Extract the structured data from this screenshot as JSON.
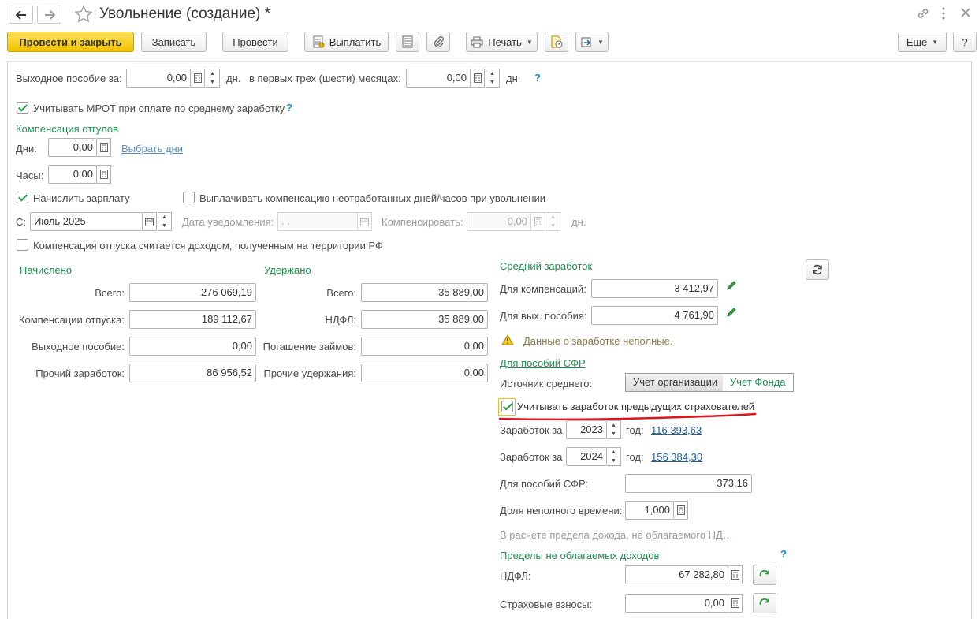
{
  "window": {
    "title": "Увольнение (создание) *"
  },
  "toolbar": {
    "post_close": "Провести и закрыть",
    "save": "Записать",
    "post": "Провести",
    "pay": "Выплатить",
    "print": "Печать",
    "more": "Еще",
    "help": "?"
  },
  "severance": {
    "label": "Выходное пособие за:",
    "days_value": "0,00",
    "days_unit": "дн.",
    "months_label": "в первых трех (шести) месяцах:",
    "months_value": "0,00",
    "months_unit": "дн.",
    "help": "?"
  },
  "mrot": {
    "label": "Учитывать МРОТ при оплате по среднему заработку",
    "checked": true,
    "help": "?"
  },
  "compensation_time_off": {
    "heading": "Компенсация отгулов",
    "days_label": "Дни:",
    "days_value": "0,00",
    "choose_days": "Выбрать дни",
    "hours_label": "Часы:",
    "hours_value": "0,00"
  },
  "salary": {
    "accrue_label": "Начислить зарплату",
    "accrue_checked": true,
    "pay_comp_label": "Выплачивать компенсацию неотработанных дней/часов при увольнении",
    "pay_comp_checked": false,
    "from_label": "С:",
    "from_value": "Июль 2025",
    "notice_label": "Дата уведомления:",
    "notice_value": " .  .",
    "compensate_label": "Компенсировать:",
    "compensate_value": "0,00",
    "compensate_unit": "дн."
  },
  "vacation_income": {
    "label": "Компенсация отпуска считается доходом, полученным на территории РФ",
    "checked": false
  },
  "accrued": {
    "heading": "Начислено",
    "total_label": "Всего:",
    "total_value": "276 069,19",
    "vacation_label": "Компенсации отпуска:",
    "vacation_value": "189 112,67",
    "severance_label": "Выходное пособие:",
    "severance_value": "0,00",
    "other_label": "Прочий заработок:",
    "other_value": "86 956,52"
  },
  "withheld": {
    "heading": "Удержано",
    "total_label": "Всего:",
    "total_value": "35 889,00",
    "ndfl_label": "НДФЛ:",
    "ndfl_value": "35 889,00",
    "loans_label": "Погашение займов:",
    "loans_value": "0,00",
    "other_label": "Прочие удержания:",
    "other_value": "0,00"
  },
  "average_earnings": {
    "heading": "Средний заработок",
    "comp_label": "Для компенсаций:",
    "comp_value": "3 412,97",
    "sev_label": "Для вых. пособия:",
    "sev_value": "4 761,90",
    "warning": "Данные о заработке неполные."
  },
  "sfr": {
    "link": "Для пособий СФР",
    "source_label": "Источник среднего:",
    "source_org": "Учет организации",
    "source_fund": "Учет Фонда",
    "prev_employers_label": "Учитывать заработок предыдущих страхователей",
    "prev_employers_checked": true,
    "earn_label": "Заработок за",
    "year1": "2023",
    "year1_amount": "116 393,63",
    "year2": "2024",
    "year2_amount": "156 384,30",
    "year_word": "год:",
    "benefit_label": "Для пособий СФР:",
    "benefit_value": "373,16",
    "part_time_label": "Доля неполного времени:",
    "part_time_value": "1,000",
    "limit_note": "В расчете предела дохода, не облагаемого НД…"
  },
  "limits": {
    "heading": "Пределы не облагаемых доходов",
    "help": "?",
    "ndfl_label": "НДФЛ:",
    "ndfl_value": "67 282,80",
    "insurance_label": "Страховые взносы:",
    "insurance_value": "0,00"
  },
  "colors": {
    "primary_button": "#f2c200",
    "section_heading": "#1d8f4e",
    "link": "#1f5fa8",
    "help": "#1d8fd2",
    "annotation": "#e0141e"
  }
}
